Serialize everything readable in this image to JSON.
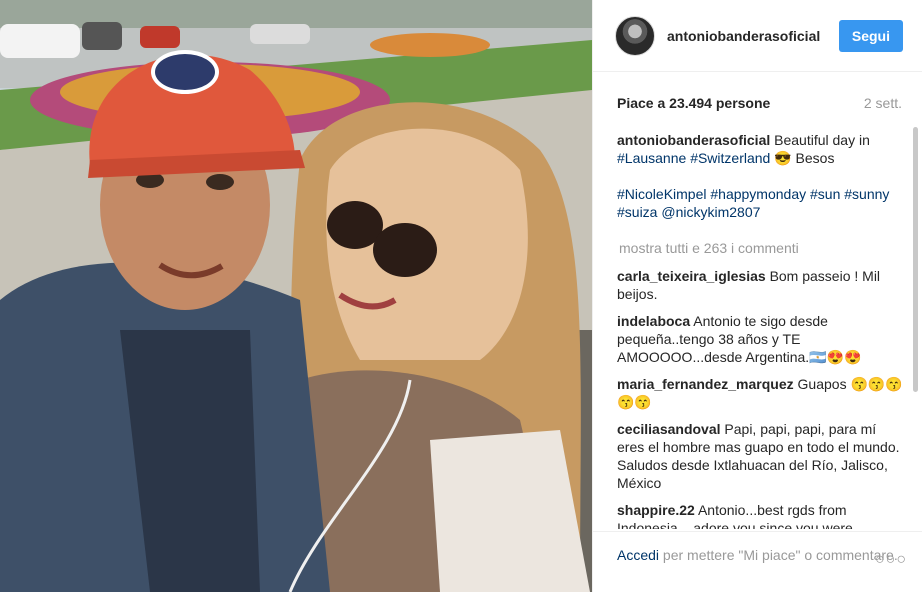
{
  "post": {
    "username": "antoniobanderasoficial",
    "follow_label": "Segui",
    "likes": "Piace a 23.494 persone",
    "age": "2 sett."
  },
  "caption": {
    "author": "antoniobanderasoficial",
    "text1": "Beautiful day in",
    "tag1": "#Lausanne",
    "tag2": "#Switzerland",
    "text2": "😎 Besos",
    "tags2": [
      "#NicoleKimpel",
      "#happymonday",
      "#sun",
      "#sunny",
      "#suiza",
      "@nickykim2807"
    ]
  },
  "show_all": "mostra tutti e 263 i commenti",
  "comments": [
    {
      "author": "carla_teixeira_iglesias",
      "text": "Bom passeio ! Mil beijos."
    },
    {
      "author": "indelaboca",
      "text": "Antonio te sigo desde pequeña..tengo 38 años y TE AMOOOOO...desde Argentina.🇦🇷😍😍"
    },
    {
      "author": "maria_fernandez_marquez",
      "text": "Guapos 😙😙😙😙😙"
    },
    {
      "author": "ceciliasandoval",
      "text": "Papi, papi, papi, para mí eres el hombre mas guapo en todo el mundo. Saludos desde Ixtlahuacan del Río, Jalisco, México"
    },
    {
      "author": "shappire.22",
      "text": "Antonio...best rgds from Indonesia....adore you since you were young...until now...always... 💖💖💖💖"
    }
  ],
  "footer": {
    "login": "Accedi",
    "rest": "per mettere \"Mi piace\" o commentare."
  },
  "icons": {
    "more": "more-options-icon"
  },
  "colors": {
    "accent": "#3897f0",
    "link": "#003569",
    "muted": "#999999"
  }
}
